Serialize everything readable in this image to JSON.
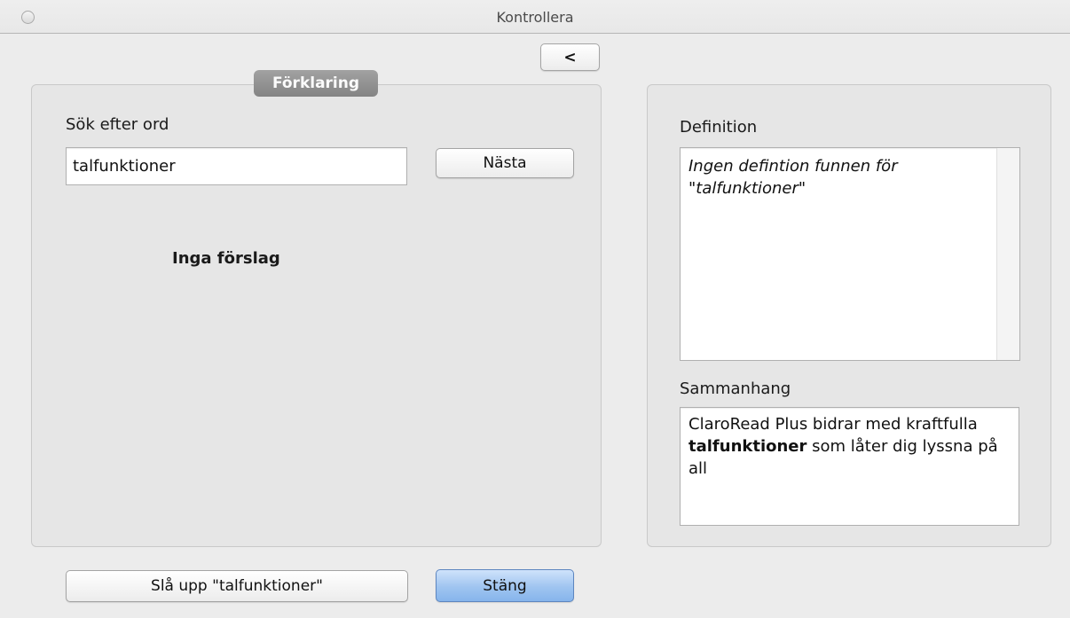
{
  "window": {
    "title": "Kontrollera"
  },
  "toolbar": {
    "back_label": "<"
  },
  "explanation_panel": {
    "title": "Förklaring",
    "search_label": "Sök efter ord",
    "search_value": "talfunktioner",
    "next_label": "Nästa",
    "suggestions_message": "Inga förslag"
  },
  "definition_panel": {
    "definition_label": "Definition",
    "definition_text": "Ingen defintion funnen för \"talfunktioner\"",
    "context_label": "Sammanhang",
    "context_before": "ClaroRead Plus bidrar med kraftfulla ",
    "context_highlight": "talfunktioner",
    "context_after": " som låter dig lyssna på all"
  },
  "footer": {
    "lookup_label": "Slå upp \"talfunktioner\"",
    "close_label": "Stäng"
  }
}
